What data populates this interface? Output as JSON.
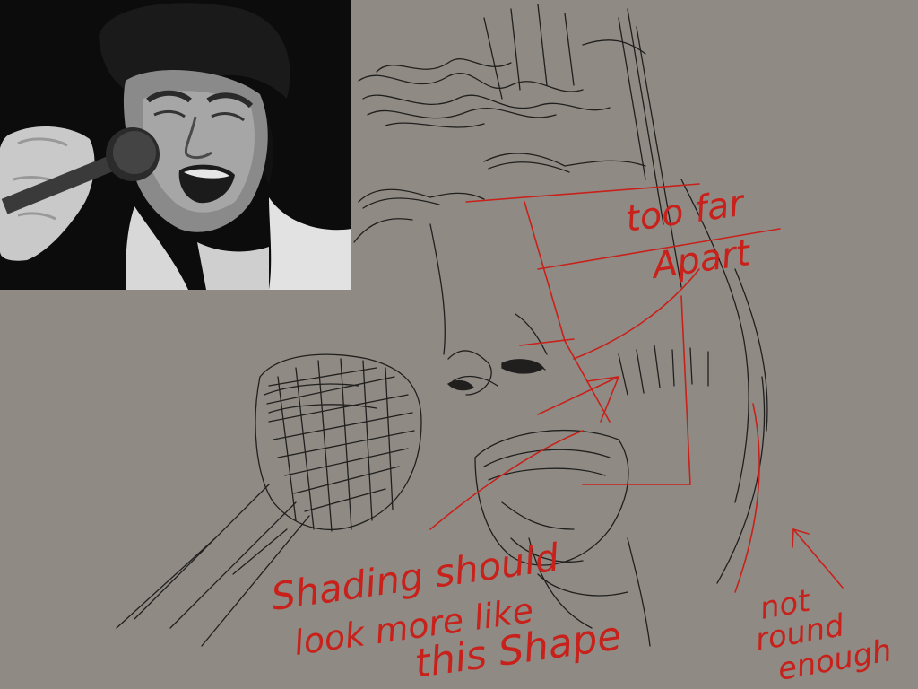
{
  "colors": {
    "background": "#8f8b84",
    "pencil": "#141414",
    "redline": "#c8201a"
  },
  "annotations": {
    "too_far": "too far",
    "apart": "Apart",
    "shading_1": "Shading should",
    "shading_2": "look more like",
    "shading_3": "this Shape",
    "not": "not",
    "round": "round",
    "enough": "enough"
  }
}
